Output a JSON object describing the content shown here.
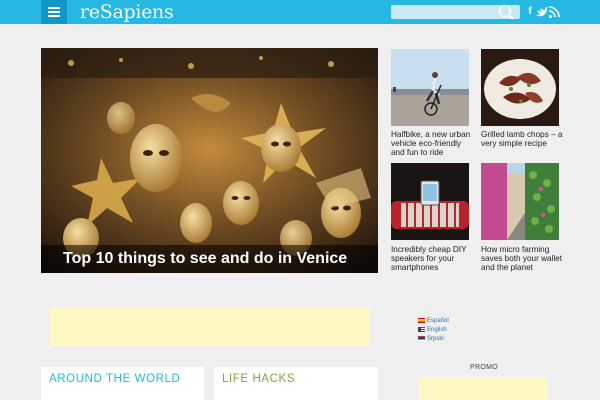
{
  "header": {
    "logo_main": "reSapiens",
    "search_placeholder": "",
    "social": [
      {
        "icon": "facebook-icon",
        "glyph": "f"
      },
      {
        "icon": "twitter-icon",
        "glyph": "t"
      },
      {
        "icon": "rss-icon",
        "glyph": "rss"
      }
    ]
  },
  "hero": {
    "title": "Top 10 things to see and do in Venice",
    "image": "venetian-carnival-masks-photo"
  },
  "articles": [
    {
      "title": "Halfbike, a new urban vehicle eco-friendly and fun to ride",
      "image": "halfbike-photo"
    },
    {
      "title": "Grilled lamb chops – a very simple recipe",
      "image": "lamb-chops-photo"
    },
    {
      "title": "Incredibly cheap DIY speakers for your smartphones",
      "image": "diy-speakers-photo"
    },
    {
      "title": "How micro farming saves both your wallet and the planet",
      "image": "micro-farming-photo"
    }
  ],
  "languages": [
    {
      "label": "Español",
      "flag": "spain-flag"
    },
    {
      "label": "English",
      "flag": "us-flag"
    },
    {
      "label": "Srpski",
      "flag": "serbia-flag"
    }
  ],
  "sections": [
    {
      "title": "AROUND THE WORLD",
      "color": "#26b7e2"
    },
    {
      "title": "LIFE HACKS",
      "color": "#7aa83c"
    }
  ],
  "promo": {
    "label": "PROMO"
  },
  "colors": {
    "accent": "#26b7e2",
    "ad_background": "#fff8c3"
  }
}
